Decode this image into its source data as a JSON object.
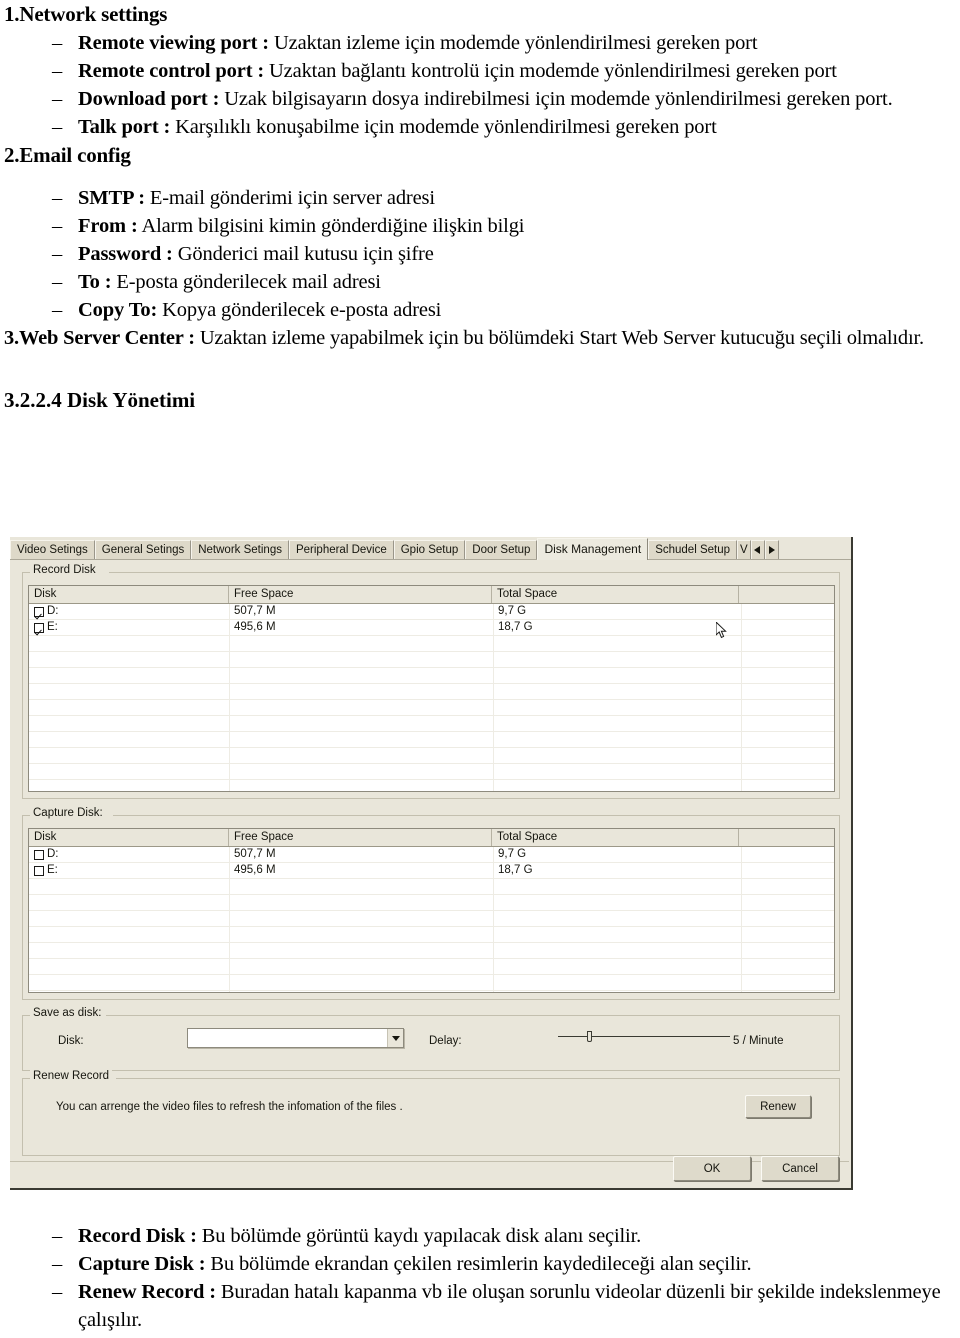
{
  "document": {
    "section1": {
      "heading": "1.Network settings",
      "bullets": [
        {
          "term": "Remote viewing port :",
          "desc": " Uzaktan izleme için modemde yönlendirilmesi gereken port"
        },
        {
          "term": "Remote control port :",
          "desc": " Uzaktan bağlantı kontrolü için modemde yönlendirilmesi gereken port"
        },
        {
          "term": "Download port :",
          "desc": " Uzak bilgisayarın dosya indirebilmesi için modemde yönlendirilmesi gereken port."
        },
        {
          "term": "Talk port :",
          "desc": " Karşılıklı konuşabilme için modemde yönlendirilmesi gereken port"
        }
      ]
    },
    "section2": {
      "heading": "2.Email config",
      "bullets": [
        {
          "term": "SMTP :",
          "desc": " E-mail gönderimi için server adresi"
        },
        {
          "term": "From :",
          "desc": " Alarm bilgisini kimin gönderdiğine ilişkin bilgi"
        },
        {
          "term": "Password :",
          "desc": " Gönderici mail kutusu için şifre"
        },
        {
          "term": "To :",
          "desc": " E-posta gönderilecek mail adresi"
        },
        {
          "term": "Copy  To:",
          "desc": " Kopya gönderilecek e-posta adresi"
        }
      ]
    },
    "section3": {
      "term": "3.Web Server Center  :",
      "desc": " Uzaktan izleme yapabilmek için bu bölümdeki Start Web Server kutucuğu seçili olmalıdır."
    },
    "section4": {
      "heading": "3.2.2.4  Disk Yönetimi"
    },
    "footer_bullets": [
      {
        "term": "Record Disk :",
        "desc": " Bu bölümde görüntü kaydı yapılacak disk alanı seçilir."
      },
      {
        "term": "Capture Disk :",
        "desc": " Bu bölümde ekrandan çekilen resimlerin kaydedileceği alan seçilir."
      },
      {
        "term": "Renew Record :",
        "desc": " Buradan hatalı kapanma vb ile oluşan sorunlu videolar düzenli bir şekilde indekslenmeye çalışılır."
      }
    ],
    "dash": "–"
  },
  "app": {
    "tabs": [
      {
        "label": "Video Setings",
        "active": false
      },
      {
        "label": "General Setings",
        "active": false
      },
      {
        "label": "Network Setings",
        "active": false
      },
      {
        "label": "Peripheral Device",
        "active": false
      },
      {
        "label": "Gpio Setup",
        "active": false
      },
      {
        "label": "Door Setup",
        "active": false
      },
      {
        "label": "Disk Management",
        "active": true
      },
      {
        "label": "Schudel Setup",
        "active": false
      },
      {
        "label": "V",
        "active": false
      }
    ],
    "tab_scroll_left": "◄",
    "tab_scroll_right": "►",
    "record_disk": {
      "legend": "Record Disk",
      "columns": [
        "Disk",
        "Free Space",
        "Total Space",
        ""
      ],
      "rows": [
        {
          "checked": true,
          "disk": "D:",
          "free": "507,7 M",
          "total": "9,7 G"
        },
        {
          "checked": true,
          "disk": "E:",
          "free": "495,6 M",
          "total": "18,7 G"
        }
      ]
    },
    "capture_disk": {
      "legend": "Capture Disk:",
      "columns": [
        "Disk",
        "Free Space",
        "Total Space",
        ""
      ],
      "rows": [
        {
          "checked": false,
          "disk": "D:",
          "free": "507,7 M",
          "total": "9,7 G"
        },
        {
          "checked": false,
          "disk": "E:",
          "free": "495,6 M",
          "total": "18,7 G"
        }
      ]
    },
    "save_as_disk": {
      "legend": "Save as disk:",
      "disk_label": "Disk:",
      "disk_value": "",
      "delay_label": "Delay:",
      "delay_value": "5 / Minute",
      "delay_percent": 10
    },
    "renew_record": {
      "legend": "Renew Record",
      "hint": "You can arrenge the video files to refresh the infomation of the files .",
      "button": "Renew"
    },
    "footer": {
      "ok": "OK",
      "cancel": "Cancel"
    },
    "colors": {
      "dialog_face": "#e9e6da",
      "tab_face": "#ded9c9",
      "active_tab": "#eceadf",
      "list_bg": "#ffffff",
      "border": "#8d8a7d",
      "text": "#16160f"
    }
  }
}
